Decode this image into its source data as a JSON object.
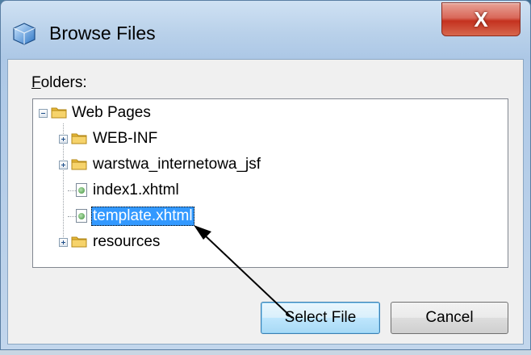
{
  "window": {
    "title": "Browse Files",
    "close_glyph": "X"
  },
  "dialog": {
    "folders_label_mnemonic": "F",
    "folders_label_rest": "olders:"
  },
  "tree": {
    "items": [
      {
        "label": "Web Pages",
        "kind": "folder",
        "expander": "minus",
        "depth": 0
      },
      {
        "label": "WEB-INF",
        "kind": "folder",
        "expander": "plus",
        "depth": 1
      },
      {
        "label": "warstwa_internetowa_jsf",
        "kind": "folder",
        "expander": "plus",
        "depth": 1
      },
      {
        "label": "index1.xhtml",
        "kind": "file",
        "depth": 1
      },
      {
        "label": "template.xhtml",
        "kind": "file",
        "depth": 1,
        "selected": true
      },
      {
        "label": "resources",
        "kind": "folder",
        "expander": "plus",
        "depth": 1
      }
    ]
  },
  "buttons": {
    "select_file": "Select File",
    "cancel": "Cancel"
  },
  "colors": {
    "selection": "#3399ff",
    "close_button": "#c4321f",
    "folder": "#e8b838"
  },
  "icons": {
    "title": "globe-cube-icon",
    "folder": "folder-icon",
    "file": "xhtml-file-icon",
    "annotation": "arrow-annotation"
  }
}
